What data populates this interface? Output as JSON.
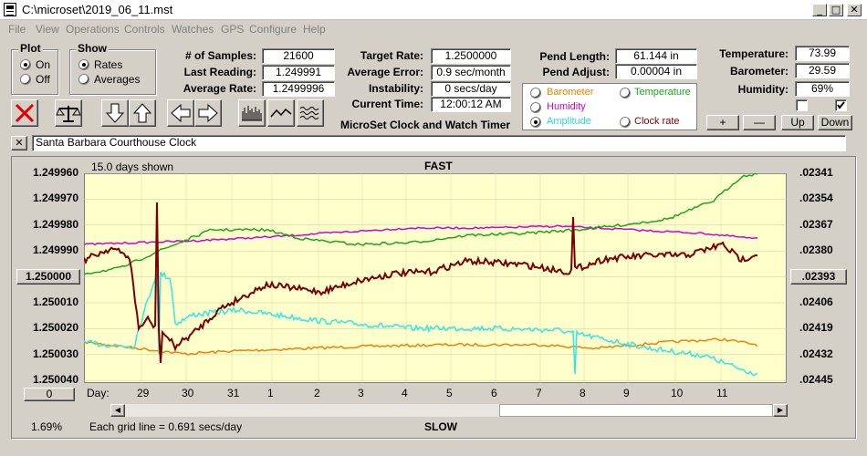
{
  "window": {
    "title": "C:\\microset\\2019_06_11.mst"
  },
  "menu": [
    "File",
    "View",
    "Operations",
    "Controls",
    "Watches",
    "GPS",
    "Configure",
    "Help"
  ],
  "plot": {
    "title": "Plot",
    "on": "On",
    "off": "Off"
  },
  "show": {
    "title": "Show",
    "rates": "Rates",
    "averages": "Averages"
  },
  "stats": {
    "samples_label": "# of Samples:",
    "samples": "21600",
    "last_label": "Last Reading:",
    "last": "1.249991",
    "avg_label": "Average Rate:",
    "avg": "1.2499996"
  },
  "targets": {
    "target_label": "Target Rate:",
    "target": "1.2500000",
    "err_label": "Average Error:",
    "err": "0.9 sec/month",
    "inst_label": "Instability:",
    "inst": "0 secs/day",
    "time_label": "Current Time:",
    "time": "12:00:12 AM"
  },
  "pend": {
    "len_label": "Pend Length:",
    "len": "61.144 in",
    "adj_label": "Pend Adjust:",
    "adj": "0.00004 in"
  },
  "env": {
    "temp_label": "Temperature:",
    "temp": "73.99",
    "baro_label": "Barometer:",
    "baro": "29.59",
    "hum_label": "Humidity:",
    "hum": "69%"
  },
  "subtitle": "MicroSet Clock and Watch Timer",
  "series_options": {
    "barometer": "Barometer",
    "temperature": "Temperature",
    "humidity": "Humidity",
    "amplitude": "Amplitude",
    "clock_rate": "Clock rate"
  },
  "adjust_buttons": {
    "plus": "+",
    "minus": "—",
    "up": "Up",
    "down": "Down"
  },
  "clock_name": "Santa Barbara Courthouse Clock",
  "close_x": "✕",
  "chart": {
    "days_shown": "15.0 days shown",
    "fast": "FAST",
    "slow": "SLOW",
    "left_ticks": [
      "1.249960",
      "1.249970",
      "1.249980",
      "1.249990",
      "1.250000",
      "1.250010",
      "1.250020",
      "1.250030",
      "1.250040"
    ],
    "right_ticks": [
      ".02341",
      ".02354",
      ".02367",
      ".02380",
      ".02393",
      ".02406",
      ".02419",
      ".02432",
      ".02445"
    ],
    "day_label": "Day:",
    "days": [
      "29",
      "30",
      "31",
      "1",
      "2",
      "3",
      "4",
      "5",
      "6",
      "7",
      "8",
      "9",
      "10",
      "11"
    ],
    "zero_button": "0",
    "percent": "1.69%",
    "grid_note": "Each grid line = 0.691 secs/day"
  },
  "colors": {
    "rate": "#7a0000",
    "temperature": "#1aa81a",
    "humidity": "#d400d4",
    "amplitude": "#33e6e6",
    "barometer": "#f08000",
    "plot_bg": "#ffffcc"
  }
}
